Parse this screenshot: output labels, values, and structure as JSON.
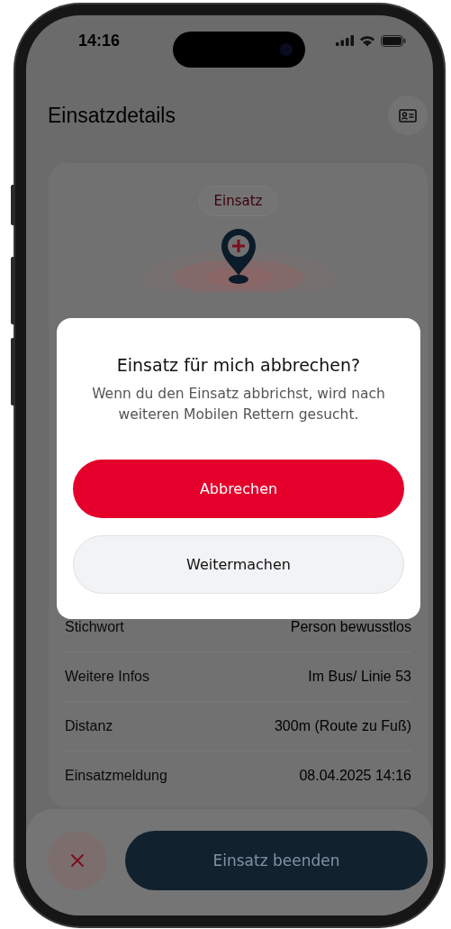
{
  "status_bar": {
    "time": "14:16"
  },
  "header": {
    "title": "Einsatzdetails"
  },
  "incident_card": {
    "badge": "Einsatz",
    "details": [
      {
        "label": "Stichwort",
        "value": "Person bewusstlos"
      },
      {
        "label": "Weitere Infos",
        "value": "Im Bus/ Linie 53"
      },
      {
        "label": "Distanz",
        "value": "300m (Route zu Fuß)"
      },
      {
        "label": "Einsatzmeldung",
        "value": "08.04.2025 14:16"
      }
    ]
  },
  "dialog": {
    "title": "Einsatz für mich abbrechen?",
    "message": "Wenn du den Einsatz abbrichst, wird nach weiteren Mobilen Rettern gesucht.",
    "buttons": [
      {
        "label": "Abbrechen",
        "kind": "primary"
      },
      {
        "label": "Weitermachen",
        "kind": "secondary"
      }
    ]
  },
  "bottom_bar": {
    "action_button": "Einsatz beenden"
  }
}
